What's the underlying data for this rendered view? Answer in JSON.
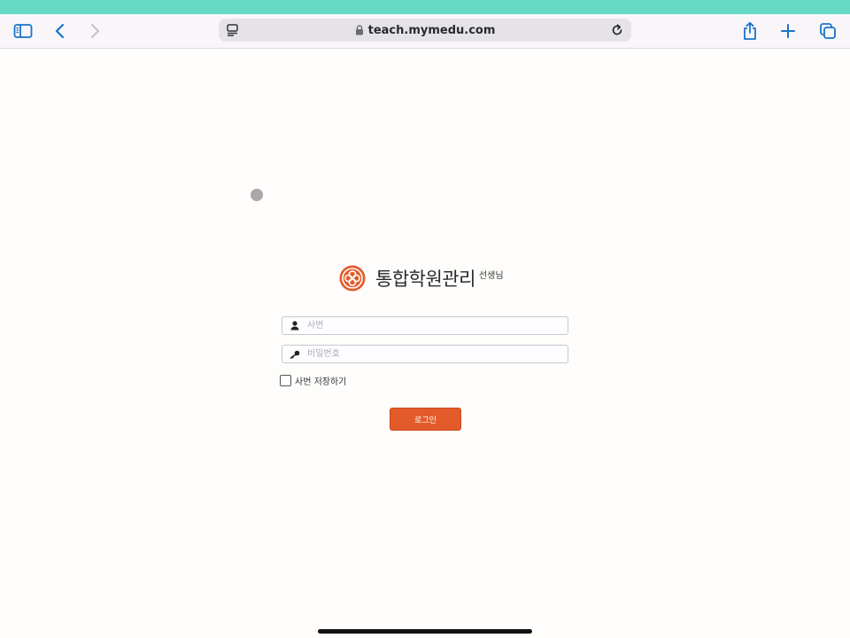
{
  "browser": {
    "url": "teach.mymedu.com",
    "icons": {
      "sidebar": "sidebar-icon",
      "back": "chevron-left-icon",
      "forward": "chevron-right-icon",
      "reader": "reader-icon",
      "lock": "lock-icon",
      "reload": "reload-icon",
      "share": "share-icon",
      "new_tab": "plus-icon",
      "tabs": "tabs-overview-icon"
    },
    "accent_color": "#1a73c8",
    "status_bar_color": "#66d9c4"
  },
  "login": {
    "brand_title": "통합학원관리",
    "brand_subtitle": "선생님",
    "id_placeholder": "사번",
    "password_placeholder": "비밀번호",
    "remember_label": "사번 저장하기",
    "remember_checked": false,
    "submit_label": "로그인",
    "brand_color": "#e35b2a"
  }
}
